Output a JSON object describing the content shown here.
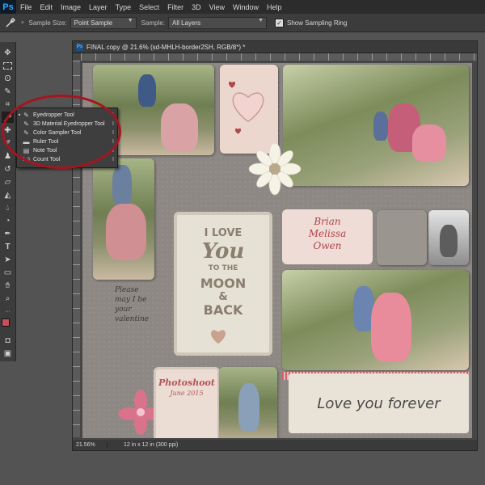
{
  "app": {
    "logo": "Ps"
  },
  "menu": [
    "File",
    "Edit",
    "Image",
    "Layer",
    "Type",
    "Select",
    "Filter",
    "3D",
    "View",
    "Window",
    "Help"
  ],
  "options": {
    "sample_size_label": "Sample Size:",
    "sample_size_value": "Point Sample",
    "sample_label": "Sample:",
    "sample_value": "All Layers",
    "sampling_ring_label": "Show Sampling Ring",
    "sampling_ring_checked": true
  },
  "flyout": {
    "items": [
      {
        "label": "Eyedropper Tool",
        "key": "I",
        "icon": "eyedropper-icon",
        "selected": true
      },
      {
        "label": "3D Material Eyedropper Tool",
        "key": "I",
        "icon": "3d-eyedropper-icon",
        "selected": false
      },
      {
        "label": "Color Sampler Tool",
        "key": "I",
        "icon": "color-sampler-icon",
        "selected": false
      },
      {
        "label": "Ruler Tool",
        "key": "I",
        "icon": "ruler-icon",
        "selected": false
      },
      {
        "label": "Note Tool",
        "key": "I",
        "icon": "note-icon",
        "selected": false
      },
      {
        "label": "Count Tool",
        "key": "I",
        "icon": "count-icon",
        "selected": false
      }
    ]
  },
  "document": {
    "tab_title": "FINAL copy @ 21.6% (sd-MHLH-border2SH, RGB/8*) *",
    "zoom": "21.56%",
    "doc_info": "12 in x 12 in (300 ppi)"
  },
  "scrapbook": {
    "quote_lines": [
      "I LOVE",
      "You",
      "TO THE",
      "MOON",
      "&",
      "BACK"
    ],
    "names": [
      "Brian",
      "Melissa",
      "Owen"
    ],
    "photoshoot_title": "Photoshoot",
    "photoshoot_date": "June 2015",
    "forever_text": "Love you forever",
    "handwritten": [
      "Please",
      "may I be",
      "your",
      "valentine"
    ]
  },
  "colors": {
    "accent_red": "#a51520",
    "foreground_swatch": "#c8505a",
    "background_swatch": "#ffffff"
  }
}
